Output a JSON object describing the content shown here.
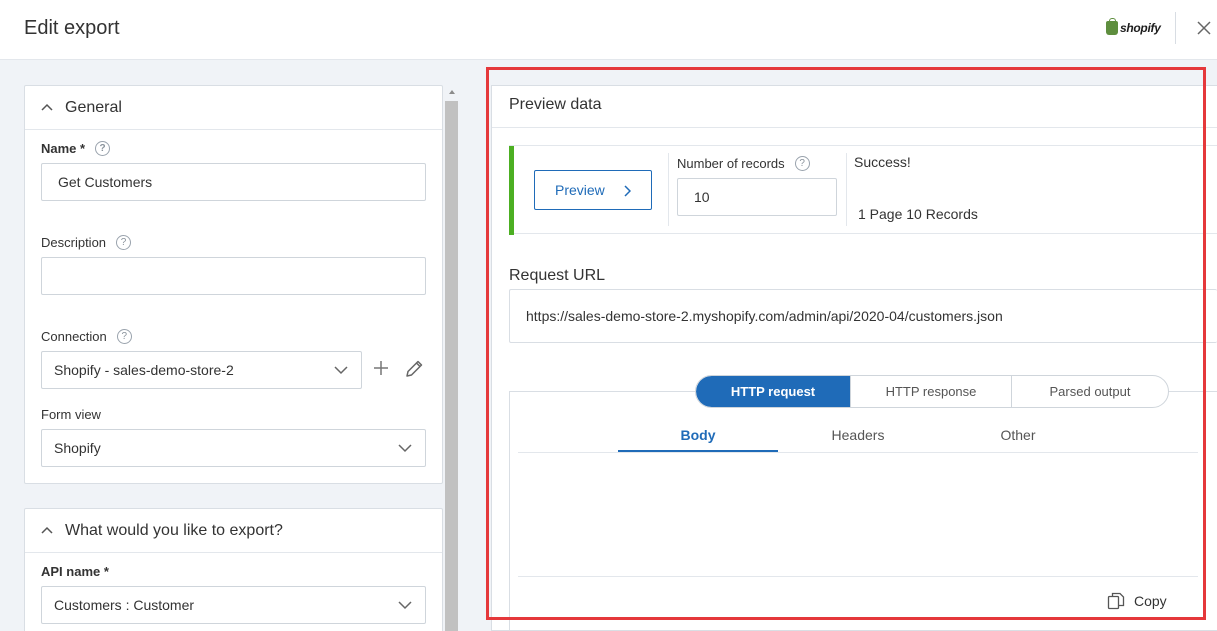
{
  "header": {
    "title": "Edit export",
    "app_logo_text": "shopify"
  },
  "general": {
    "section_title": "General",
    "name_label": "Name *",
    "name_value": "Get Customers",
    "description_label": "Description",
    "description_value": "",
    "connection_label": "Connection",
    "connection_value": "Shopify - sales-demo-store-2",
    "form_view_label": "Form view",
    "form_view_value": "Shopify",
    "help_glyph": "?"
  },
  "export_section": {
    "section_title": "What would you like to export?",
    "api_name_label": "API name *",
    "api_name_value": "Customers : Customer"
  },
  "preview": {
    "title": "Preview data",
    "preview_button": "Preview",
    "number_of_records_label": "Number of records",
    "number_of_records_value": "10",
    "status_text": "Success!",
    "records_summary": "1 Page 10 Records",
    "request_url_label": "Request URL",
    "request_url": "https://sales-demo-store-2.myshopify.com/admin/api/2020-04/customers.json",
    "segments": [
      "HTTP request",
      "HTTP response",
      "Parsed output"
    ],
    "subtabs": [
      "Body",
      "Headers",
      "Other"
    ],
    "copy_label": "Copy"
  },
  "colors": {
    "accent_blue": "#1f6bb8",
    "success_green": "#4caf22",
    "highlight_red": "#e5383b"
  }
}
